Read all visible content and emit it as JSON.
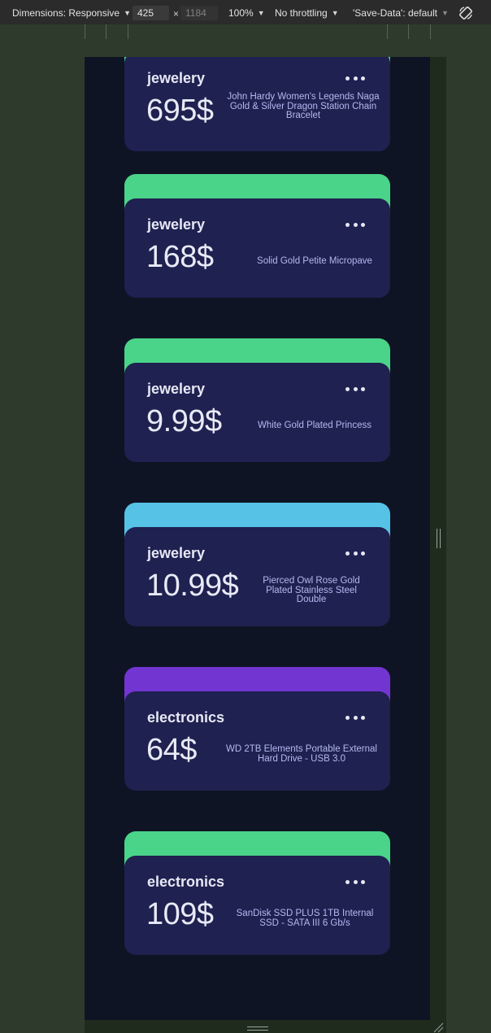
{
  "devtools": {
    "dimensions_label": "Dimensions: Responsive",
    "width_value": "425",
    "height_value": "1184",
    "times": "×",
    "zoom": "100%",
    "throttling": "No throttling",
    "save_data": "'Save-Data': default"
  },
  "cards": [
    {
      "category": "jewelery",
      "price": "695$",
      "title": "John Hardy Women's Legends Naga Gold & Silver Dragon Station Chain Bracelet",
      "accent": "#4ad489"
    },
    {
      "category": "jewelery",
      "price": "168$",
      "title": "Solid Gold Petite Micropave",
      "accent": "#4ad489"
    },
    {
      "category": "jewelery",
      "price": "9.99$",
      "title": "White Gold Plated Princess",
      "accent": "#4ad489"
    },
    {
      "category": "jewelery",
      "price": "10.99$",
      "title": "Pierced Owl Rose Gold Plated Stainless Steel Double",
      "accent": "#56c2e6"
    },
    {
      "category": "electronics",
      "price": "64$",
      "title": "WD 2TB Elements Portable External Hard Drive - USB 3.0",
      "accent": "#7335d2"
    },
    {
      "category": "electronics",
      "price": "109$",
      "title": "SanDisk SSD PLUS 1TB Internal SSD - SATA III 6 Gb/s",
      "accent": "#4ad489"
    }
  ]
}
